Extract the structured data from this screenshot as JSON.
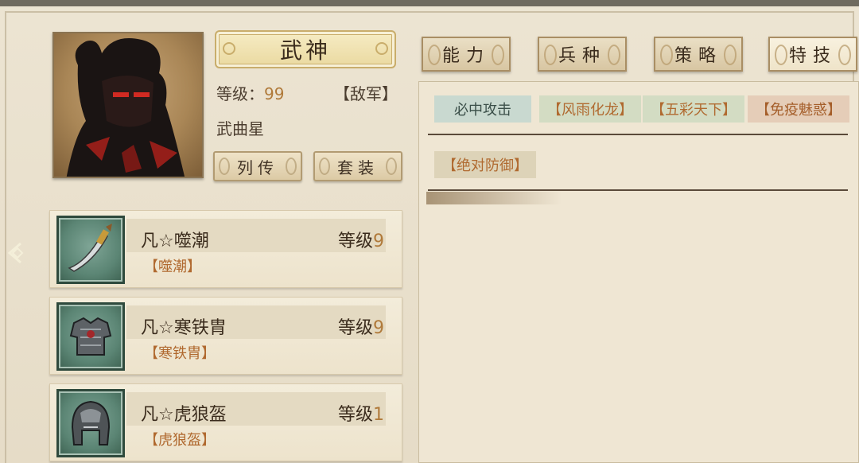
{
  "hero": {
    "title": "武神",
    "level_label": "等级：",
    "level_value": "99",
    "faction": "【敌军】",
    "star": "武曲星",
    "bio_button": "列传",
    "set_button": "套装"
  },
  "tabs": [
    {
      "label": "能力"
    },
    {
      "label": "兵种"
    },
    {
      "label": "策略"
    },
    {
      "label": "特技"
    }
  ],
  "skills": [
    {
      "label": "必中攻击"
    },
    {
      "label": "【风雨化龙】"
    },
    {
      "label": "【五彩天下】"
    },
    {
      "label": "【免疫魅惑】"
    },
    {
      "label": "【绝对防御】"
    }
  ],
  "equipment": [
    {
      "name": "凡☆噬潮",
      "sub": "【噬潮】",
      "level_label": "等级",
      "level": "9",
      "icon": "blade-weapon-icon"
    },
    {
      "name": "凡☆寒铁胄",
      "sub": "【寒铁胄】",
      "level_label": "等级",
      "level": "9",
      "icon": "armor-icon"
    },
    {
      "name": "凡☆虎狼盔",
      "sub": "【虎狼盔】",
      "level_label": "等级",
      "level": "1",
      "icon": "helmet-icon"
    }
  ],
  "colors": {
    "accent_orange": "#b07a3a",
    "panel_bg": "#efe6d3",
    "item_icon_bg": "#5b8574"
  }
}
